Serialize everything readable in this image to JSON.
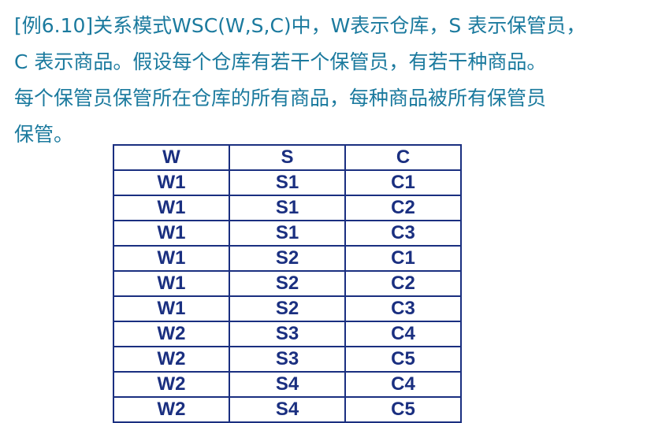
{
  "paragraph": {
    "line1": "[例6.10]关系模式WSC(W,S,C)中，W表示仓库，S 表示保管员，",
    "line2": "C 表示商品。假设每个仓库有若干个保管员，有若干种商品。",
    "line3": "每个保管员保管所在仓库的所有商品，每种商品被所有保管员",
    "line4": "保管。"
  },
  "table": {
    "headers": [
      "W",
      "S",
      "C"
    ],
    "rows": [
      [
        "W1",
        "S1",
        "C1"
      ],
      [
        "W1",
        "S1",
        "C2"
      ],
      [
        "W1",
        "S1",
        "C3"
      ],
      [
        "W1",
        "S2",
        "C1"
      ],
      [
        "W1",
        "S2",
        "C2"
      ],
      [
        "W1",
        "S2",
        "C3"
      ],
      [
        "W2",
        "S3",
        "C4"
      ],
      [
        "W2",
        "S3",
        "C5"
      ],
      [
        "W2",
        "S4",
        "C4"
      ],
      [
        "W2",
        "S4",
        "C5"
      ]
    ]
  },
  "colors": {
    "text": "#1b7a9e",
    "table": "#1a2f80"
  }
}
